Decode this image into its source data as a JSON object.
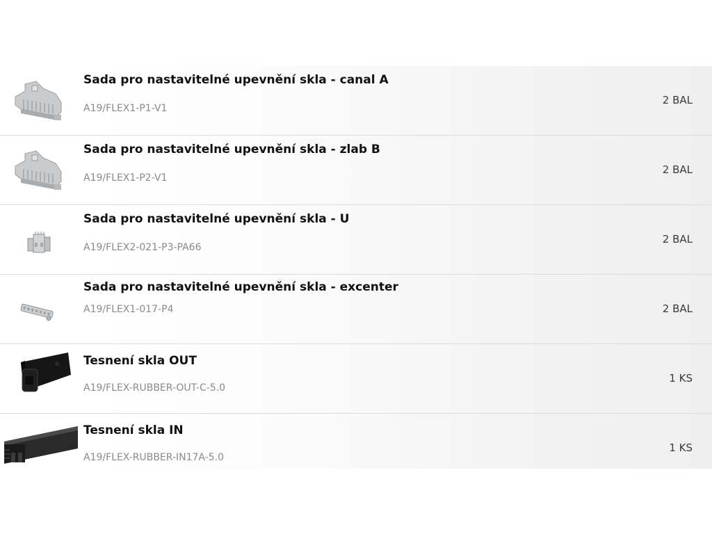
{
  "items": [
    {
      "title": "Sada pro nastavitelné upevnění skla - canal A",
      "code": "A19/FLEX1-P1-V1",
      "qty": "2 BAL",
      "icon": "glass-clip-kit-icon"
    },
    {
      "title": "Sada pro nastavitelné upevnění skla - zlab B",
      "code": "A19/FLEX1-P2-V1",
      "qty": "2 BAL",
      "icon": "glass-clip-kit-icon"
    },
    {
      "title": "Sada pro nastavitelné upevnění skla - U",
      "code": "A19/FLEX2-021-P3-PA66",
      "qty": "2 BAL",
      "icon": "u-clip-icon"
    },
    {
      "title": "Sada pro nastavitelné upevnění skla - excenter",
      "code": "A19/FLEX1-017-P4",
      "qty": "2 BAL",
      "icon": "eccentric-strip-icon"
    },
    {
      "title": "Tesnení skla OUT",
      "code": "A19/FLEX-RUBBER-OUT-C-5.0",
      "qty": "1 KS",
      "icon": "rubber-seal-out-icon"
    },
    {
      "title": "Tesnení skla IN",
      "code": "A19/FLEX-RUBBER-IN17A-5.0",
      "qty": "1 KS",
      "icon": "rubber-seal-in-icon"
    }
  ]
}
